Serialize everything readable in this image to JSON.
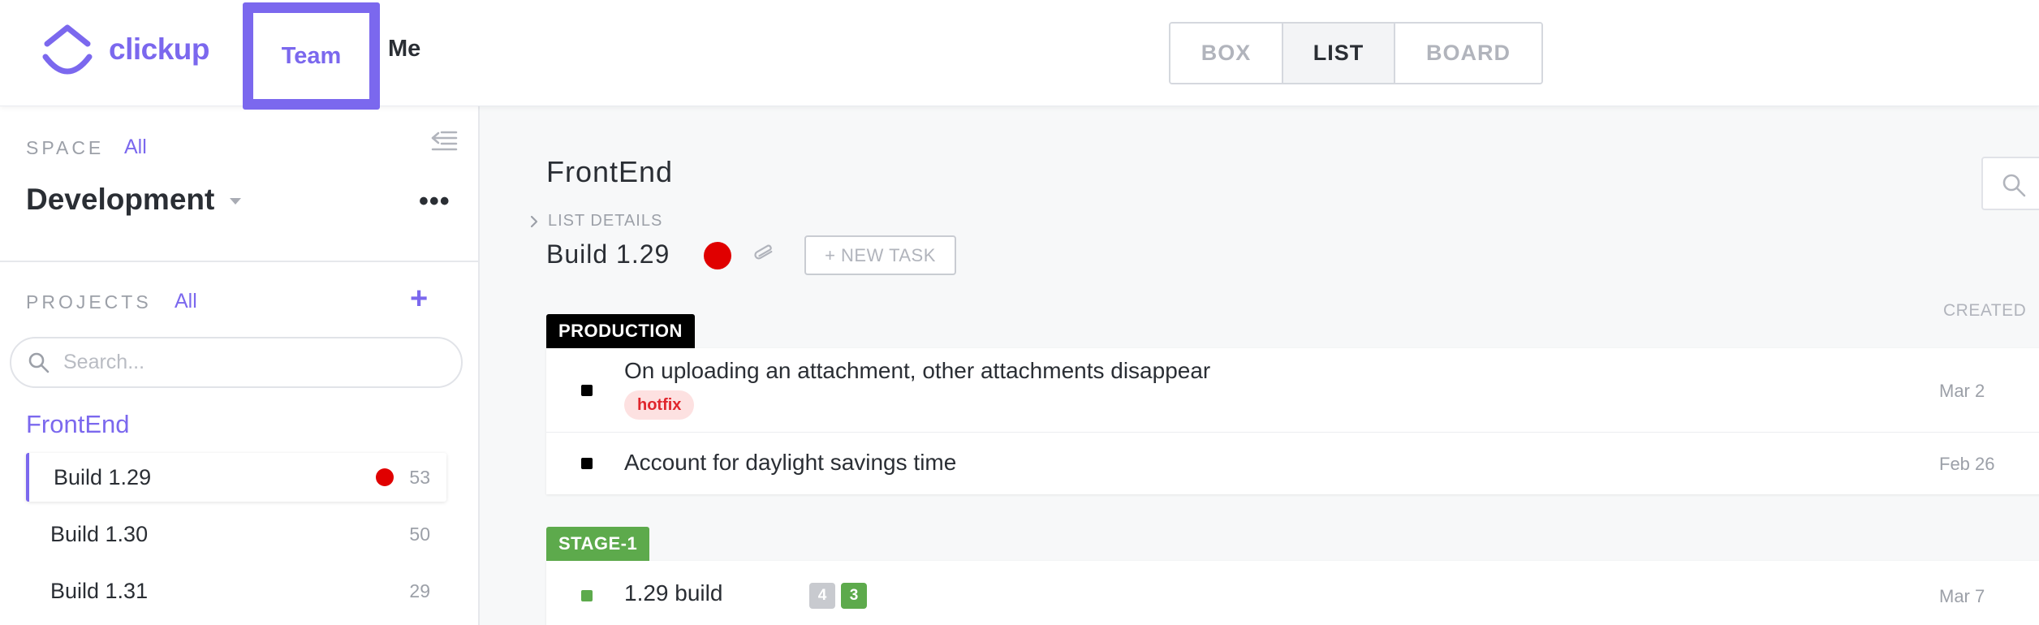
{
  "topbar": {
    "logo_text": "clickup",
    "nav_tabs": [
      "Team",
      "Me"
    ],
    "views": [
      "BOX",
      "LIST",
      "BOARD"
    ],
    "active_view": "LIST",
    "accent_color": "#7b68ee"
  },
  "sidebar": {
    "space_label": "SPACE",
    "space_all": "All",
    "space_name": "Development",
    "space_more": "•••",
    "projects_label": "PROJECTS",
    "projects_all": "All",
    "projects_add": "+",
    "search_placeholder": "Search...",
    "project_name": "FrontEnd",
    "lists": [
      {
        "label": "Build 1.29",
        "count": "53",
        "active": true,
        "status_color": "#e00000"
      },
      {
        "label": "Build 1.30",
        "count": "50",
        "active": false
      },
      {
        "label": "Build 1.31",
        "count": "29",
        "active": false
      }
    ]
  },
  "main": {
    "title": "FrontEnd",
    "list_details_label": "LIST DETAILS",
    "list_name": "Build 1.29",
    "list_status_color": "#e00000",
    "new_task_label": "+ NEW TASK",
    "column_created": "CREATED",
    "groups": [
      {
        "name": "PRODUCTION",
        "color": "#000000",
        "tasks": [
          {
            "name": "On uploading an attachment, other attachments disappear",
            "tag": "hotfix",
            "created": "Mar 2"
          },
          {
            "name": "Account for daylight savings time",
            "created": "Feb 26"
          }
        ]
      },
      {
        "name": "STAGE-1",
        "color": "#5daa4c",
        "tasks": [
          {
            "name": "1.29 build",
            "badges": [
              "4",
              "3"
            ],
            "created": "Mar 7"
          }
        ]
      }
    ]
  }
}
